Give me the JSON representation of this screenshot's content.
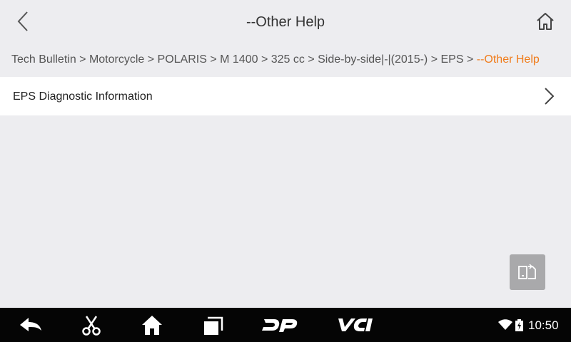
{
  "header": {
    "title": "--Other Help",
    "back_icon": "chevron-left-icon",
    "home_icon": "home-icon"
  },
  "breadcrumb": {
    "path": "Tech Bulletin > Motorcycle > POLARIS > M 1400 > 325 cc > Side-by-side|-|(2015-) > EPS > ",
    "current": "--Other Help"
  },
  "list": {
    "items": [
      {
        "label": "EPS Diagnostic Information",
        "icon": "chevron-right-icon"
      }
    ]
  },
  "float_button": {
    "icon": "screen-switch-icon"
  },
  "navbar": {
    "icons": [
      "back-arrow-icon",
      "scissors-icon",
      "home-icon",
      "recent-apps-icon",
      "dp-logo-icon",
      "vci-logo-icon"
    ],
    "status": {
      "wifi_icon": "wifi-icon",
      "battery_icon": "battery-charging-icon",
      "time": "10:50"
    }
  },
  "colors": {
    "accent": "#f07c1b",
    "background": "#ededf0",
    "navbar": "#050505"
  }
}
